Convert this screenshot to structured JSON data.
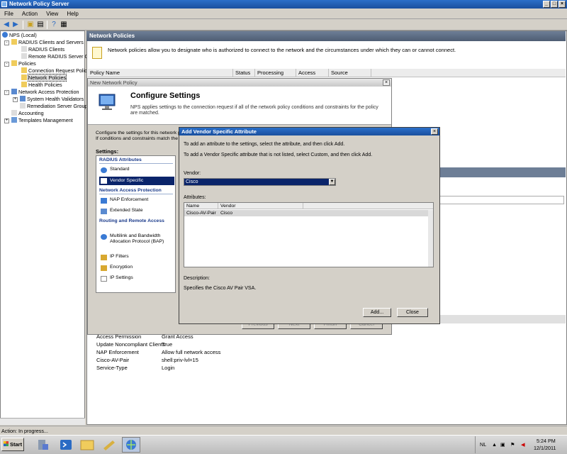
{
  "window": {
    "title": "Network Policy Server"
  },
  "menu": [
    "File",
    "Action",
    "View",
    "Help"
  ],
  "tree": {
    "items": [
      {
        "label": "NPS (Local)"
      },
      {
        "label": "RADIUS Clients and Servers"
      },
      {
        "label": "RADIUS Clients"
      },
      {
        "label": "Remote RADIUS Server G"
      },
      {
        "label": "Policies"
      },
      {
        "label": "Connection Request Polic"
      },
      {
        "label": "Network Policies"
      },
      {
        "label": "Health Policies"
      },
      {
        "label": "Network Access Protection"
      },
      {
        "label": "System Health Validators"
      },
      {
        "label": "Remediation Server Group"
      },
      {
        "label": "Accounting"
      },
      {
        "label": "Templates Management"
      }
    ]
  },
  "right_pane": {
    "header": "Network Policies",
    "description": "Network policies allow you to designate who is authorized to connect to the network and the circumstances under which they can or cannot connect.",
    "columns": [
      "Policy Name",
      "Status",
      "Processing Order",
      "Access Type",
      "Source"
    ],
    "properties": [
      {
        "name": "Access Permission",
        "value": "Grant Access"
      },
      {
        "name": "Update Noncompliant Clients",
        "value": "True"
      },
      {
        "name": "NAP Enforcement",
        "value": "Allow full network access"
      },
      {
        "name": "Cisco-AV-Pair",
        "value": "shell:priv-lvl=15"
      },
      {
        "name": "Service-Type",
        "value": "Login"
      }
    ]
  },
  "wizard": {
    "title": "New Network Policy",
    "heading": "Configure Settings",
    "heading_desc": "NPS applies settings to the connection request if all of the network policy conditions and constraints for the policy are matched.",
    "intro_line1": "Configure the settings for this network p",
    "intro_line2": "If conditions and constraints match the c",
    "settings_label": "Settings:",
    "groups": {
      "radius": "RADIUS Attributes",
      "nap": "Network Access Protection",
      "rras": "Routing and Remote Access"
    },
    "items": {
      "standard": "Standard",
      "vendor_specific": "Vendor Specific",
      "nap_enforcement": "NAP Enforcement",
      "extended_state": "Extended State",
      "multilink": "Multilink and Bandwidth Allocation Protocol (BAP)",
      "ip_filters": "IP Filters",
      "encryption": "Encryption",
      "ip_settings": "IP Settings"
    },
    "buttons": {
      "previous": "Previous",
      "next": "Next",
      "finish": "Finish",
      "cancel": "Cancel"
    }
  },
  "vsa_dialog": {
    "title": "Add Vendor Specific Attribute",
    "instruction1": "To add an attribute to the settings, select the attribute, and then click Add.",
    "instruction2": "To add a Vendor Specific attribute that is not listed, select Custom, and then click Add.",
    "vendor_label": "Vendor:",
    "vendor_value": "Cisco",
    "attributes_label": "Attributes:",
    "columns": [
      "Name",
      "Vendor"
    ],
    "rows": [
      {
        "name": "Cisco-AV-Pair",
        "vendor": "Cisco"
      }
    ],
    "description_label": "Description:",
    "description": "Specifies the Cisco AV Pair VSA.",
    "add_button": "Add...",
    "close_button": "Close"
  },
  "status_bar": "Action:  In progress...",
  "taskbar": {
    "start": "Start",
    "lang": "NL",
    "time": "5:24 PM",
    "date": "12/1/2011"
  },
  "colors": {
    "title_bar": "#1a4f9e",
    "selection": "#0a246a",
    "pane_header": "#4e5d73"
  }
}
